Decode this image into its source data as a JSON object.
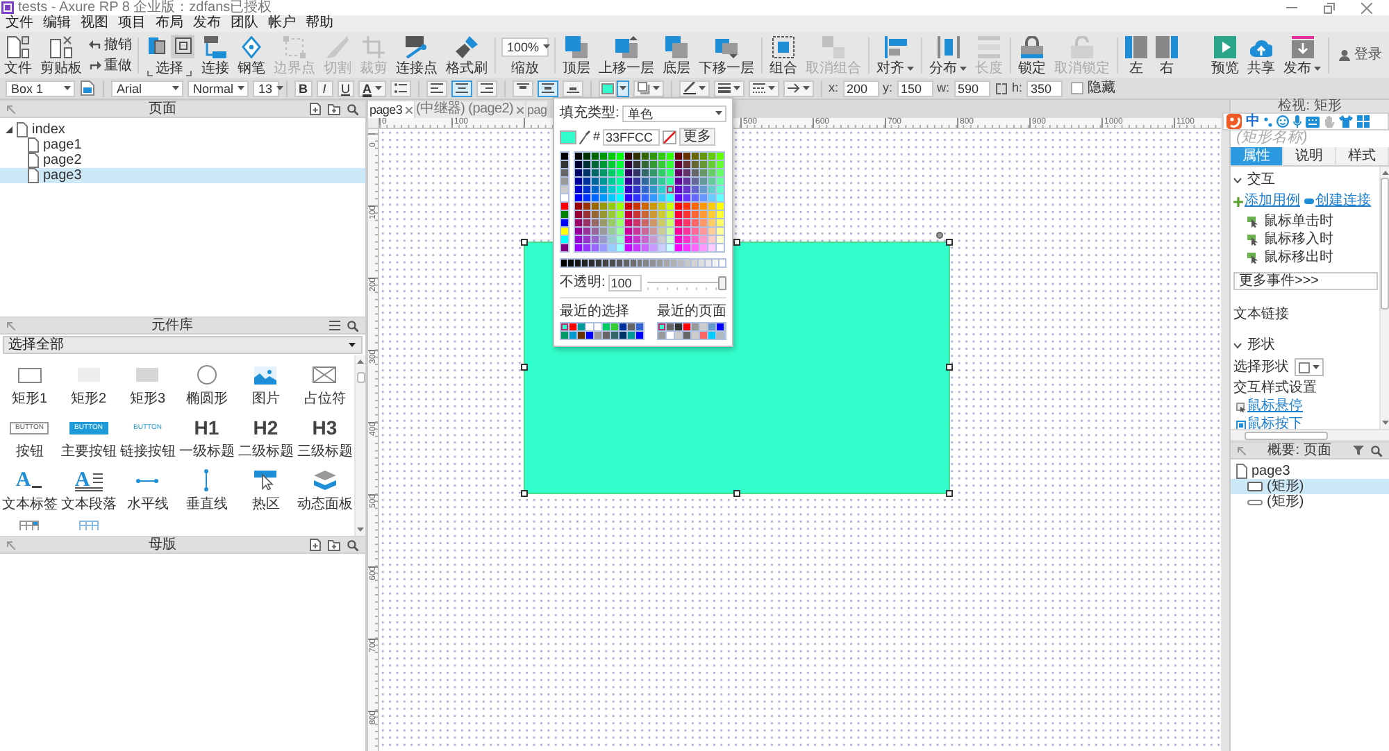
{
  "window": {
    "title": "tests - Axure RP 8 企业版：zdfans已授权"
  },
  "menu": [
    "文件",
    "编辑",
    "视图",
    "项目",
    "布局",
    "发布",
    "团队",
    "帐户",
    "帮助"
  ],
  "toolbar": {
    "groups": [
      [
        {
          "kind": "file",
          "label": "文件",
          "disabled": false
        },
        {
          "kind": "paste",
          "label": "剪贴板",
          "disabled": false
        },
        {
          "kind": "history",
          "undo": "撤销",
          "redo": "重做",
          "disabled": false
        }
      ],
      [
        {
          "kind": "select",
          "label": "选择",
          "modes": [
            {
              "kind": "intersect",
              "selected": false
            },
            {
              "kind": "contain",
              "selected": true
            }
          ],
          "disabled": false
        },
        {
          "kind": "connect",
          "label": "连接",
          "disabled": false
        },
        {
          "kind": "pen",
          "label": "钢笔",
          "disabled": false
        },
        {
          "kind": "points",
          "label": "边界点",
          "disabled": true
        },
        {
          "kind": "slice",
          "label": "切割",
          "disabled": true
        },
        {
          "kind": "crop",
          "label": "裁剪",
          "disabled": true
        },
        {
          "kind": "connector",
          "label": "连接点",
          "disabled": false
        },
        {
          "kind": "painter",
          "label": "格式刷",
          "disabled": false
        }
      ],
      [
        {
          "kind": "zoom",
          "value": "100%",
          "label": "缩放"
        }
      ],
      [
        {
          "kind": "top",
          "label": "顶层",
          "disabled": false
        },
        {
          "kind": "forward",
          "label": "上移一层",
          "disabled": false
        },
        {
          "kind": "bottom",
          "label": "底层",
          "disabled": false
        },
        {
          "kind": "backward",
          "label": "下移一层",
          "disabled": false
        }
      ],
      [
        {
          "kind": "group",
          "label": "组合",
          "disabled": false
        },
        {
          "kind": "ungroup",
          "label": "取消组合",
          "disabled": true
        }
      ],
      [
        {
          "kind": "align",
          "label": "对齐",
          "dropdown": true,
          "disabled": false
        }
      ],
      [
        {
          "kind": "distribute",
          "label": "分布",
          "dropdown": true,
          "disabled": false
        },
        {
          "kind": "spacing",
          "label": "长度",
          "disabled": true
        }
      ],
      [
        {
          "kind": "lock",
          "label": "锁定",
          "disabled": false
        },
        {
          "kind": "unlock",
          "label": "取消锁定",
          "disabled": true
        }
      ],
      [
        {
          "kind": "left-panel",
          "label": "左",
          "disabled": false
        },
        {
          "kind": "right-panel",
          "label": "右",
          "disabled": false
        }
      ]
    ],
    "right": [
      {
        "kind": "preview",
        "label": "预览",
        "disabled": false
      },
      {
        "kind": "share",
        "label": "共享",
        "disabled": false
      },
      {
        "kind": "publish",
        "label": "发布",
        "dropdown": true,
        "disabled": false
      }
    ],
    "login": "登录"
  },
  "format_bar": {
    "widget": "Box 1",
    "font": "Arial",
    "weight": "Normal",
    "size": "13",
    "styles": [
      {
        "kind": "bold",
        "label": "B",
        "on": false
      },
      {
        "kind": "italic",
        "label": "I",
        "on": false
      },
      {
        "kind": "underline",
        "label": "U",
        "on": false
      }
    ],
    "text_color": {
      "label": "A"
    },
    "h_align": [
      {
        "kind": "left",
        "selected": false
      },
      {
        "kind": "center",
        "selected": true
      },
      {
        "kind": "right",
        "selected": false
      }
    ],
    "v_align": [
      {
        "kind": "top",
        "selected": false
      },
      {
        "kind": "middle",
        "selected": true
      },
      {
        "kind": "bottom",
        "selected": false
      }
    ],
    "fill": {
      "open": true
    },
    "geometry": [
      {
        "kind": "coord",
        "label": "x:",
        "value": "200"
      },
      {
        "kind": "coord",
        "label": "y:",
        "value": "150"
      },
      {
        "kind": "coord",
        "label": "w:",
        "value": "590"
      },
      {
        "kind": "height",
        "label": "h:",
        "value": "350"
      }
    ],
    "hidden": {
      "label": "隐藏",
      "checked": false
    }
  },
  "pages_panel": {
    "title": "页面",
    "tree": [
      {
        "label": "index",
        "expanded": true,
        "selected": false,
        "children": [
          {
            "label": "page1",
            "selected": false
          },
          {
            "label": "page2",
            "selected": false
          },
          {
            "label": "page3",
            "selected": true
          }
        ]
      }
    ]
  },
  "library_panel": {
    "title": "元件库",
    "filter": "选择全部",
    "widgets": [
      {
        "kind": "rect",
        "label": "矩形1"
      },
      {
        "kind": "rect-light",
        "label": "矩形2"
      },
      {
        "kind": "rect-gray",
        "label": "矩形3"
      },
      {
        "kind": "ellipse",
        "label": "椭圆形"
      },
      {
        "kind": "image",
        "label": "图片"
      },
      {
        "kind": "placeholder",
        "label": "占位符"
      },
      {
        "kind": "button",
        "glyph": "BUTTON",
        "label": "按钮"
      },
      {
        "kind": "button-primary",
        "glyph": "BUTTON",
        "label": "主要按钮"
      },
      {
        "kind": "button-link",
        "glyph": "BUTTON",
        "label": "链接按钮"
      },
      {
        "kind": "heading",
        "glyph": "H1",
        "label": "一级标题"
      },
      {
        "kind": "heading",
        "glyph": "H2",
        "label": "二级标题"
      },
      {
        "kind": "heading",
        "glyph": "H3",
        "label": "三级标题"
      },
      {
        "kind": "text-label",
        "glyph": "A",
        "label": "文本标签"
      },
      {
        "kind": "text-paragraph",
        "glyph": "A",
        "label": "文本段落"
      },
      {
        "kind": "hline",
        "label": "水平线"
      },
      {
        "kind": "vline",
        "label": "垂直线"
      },
      {
        "kind": "hotspot",
        "label": "热区"
      },
      {
        "kind": "dynamic-panel",
        "label": "动态面板"
      },
      {
        "kind": "table"
      },
      {
        "kind": "repeater"
      }
    ]
  },
  "masters_panel": {
    "title": "母版"
  },
  "editor": {
    "tabs": [
      {
        "label": "page3",
        "selected": true,
        "closable": true
      },
      {
        "label": "(中继器) (page2)",
        "selected": false,
        "closable": true
      },
      {
        "label": "pag",
        "selected": false
      }
    ],
    "rulers": {
      "horizontal": [
        "0",
        "100",
        "500",
        "600",
        "700",
        "800",
        "900",
        "1000",
        "1100"
      ],
      "vertical": [
        "0",
        "100",
        "200",
        "300",
        "400",
        "500",
        "600",
        "700",
        "800"
      ]
    },
    "widgets": [
      {
        "kind": "rectangle",
        "color": "#33ffcc",
        "selected": true
      }
    ]
  },
  "fill_picker": {
    "type_label": "填充类型:",
    "type": "单色",
    "hash": "#",
    "hex": "33FFCC",
    "more": "更多",
    "basic": [
      {
        "color": "#000000",
        "selected": false
      },
      {
        "color": "#333333",
        "selected": false
      },
      {
        "color": "#666666",
        "selected": false
      },
      {
        "color": "#999999",
        "selected": false
      },
      {
        "color": "#cccccc",
        "selected": false
      },
      {
        "color": "#ffffff",
        "selected": false
      },
      {
        "color": "#ff0000",
        "selected": false
      },
      {
        "color": "#008000",
        "selected": false
      },
      {
        "color": "#0000ff",
        "selected": false
      },
      {
        "color": "#ffff00",
        "selected": false
      },
      {
        "color": "#00ffff",
        "selected": false
      },
      {
        "color": "#800080",
        "selected": false
      }
    ],
    "palette": [
      {
        "color": "#000000",
        "selected": false
      },
      {
        "color": "#003300",
        "selected": false
      },
      {
        "color": "#006600",
        "selected": false
      },
      {
        "color": "#009900",
        "selected": false
      },
      {
        "color": "#00cc00",
        "selected": false
      },
      {
        "color": "#00ff00",
        "selected": false
      },
      {
        "color": "#330000",
        "selected": false
      },
      {
        "color": "#333300",
        "selected": false
      },
      {
        "color": "#336600",
        "selected": false
      },
      {
        "color": "#339900",
        "selected": false
      },
      {
        "color": "#33cc00",
        "selected": false
      },
      {
        "color": "#33ff00",
        "selected": false
      },
      {
        "color": "#660000",
        "selected": false
      },
      {
        "color": "#663300",
        "selected": false
      },
      {
        "color": "#666600",
        "selected": false
      },
      {
        "color": "#669900",
        "selected": false
      },
      {
        "color": "#66cc00",
        "selected": false
      },
      {
        "color": "#66ff00",
        "selected": false
      },
      {
        "color": "#000033",
        "selected": false
      },
      {
        "color": "#003333",
        "selected": false
      },
      {
        "color": "#006633",
        "selected": false
      },
      {
        "color": "#009933",
        "selected": false
      },
      {
        "color": "#00cc33",
        "selected": false
      },
      {
        "color": "#00ff33",
        "selected": false
      },
      {
        "color": "#330033",
        "selected": false
      },
      {
        "color": "#333333",
        "selected": false
      },
      {
        "color": "#336633",
        "selected": false
      },
      {
        "color": "#339933",
        "selected": false
      },
      {
        "color": "#33cc33",
        "selected": false
      },
      {
        "color": "#33ff33",
        "selected": false
      },
      {
        "color": "#660033",
        "selected": false
      },
      {
        "color": "#663333",
        "selected": false
      },
      {
        "color": "#666633",
        "selected": false
      },
      {
        "color": "#669933",
        "selected": false
      },
      {
        "color": "#66cc33",
        "selected": false
      },
      {
        "color": "#66ff33",
        "selected": false
      },
      {
        "color": "#000066",
        "selected": false
      },
      {
        "color": "#003366",
        "selected": false
      },
      {
        "color": "#006666",
        "selected": false
      },
      {
        "color": "#009966",
        "selected": false
      },
      {
        "color": "#00cc66",
        "selected": false
      },
      {
        "color": "#00ff66",
        "selected": false
      },
      {
        "color": "#330066",
        "selected": false
      },
      {
        "color": "#333366",
        "selected": false
      },
      {
        "color": "#336666",
        "selected": false
      },
      {
        "color": "#339966",
        "selected": false
      },
      {
        "color": "#33cc66",
        "selected": false
      },
      {
        "color": "#33ff66",
        "selected": false
      },
      {
        "color": "#660066",
        "selected": false
      },
      {
        "color": "#663366",
        "selected": false
      },
      {
        "color": "#666666",
        "selected": false
      },
      {
        "color": "#669966",
        "selected": false
      },
      {
        "color": "#66cc66",
        "selected": false
      },
      {
        "color": "#66ff66",
        "selected": false
      },
      {
        "color": "#000099",
        "selected": false
      },
      {
        "color": "#003399",
        "selected": false
      },
      {
        "color": "#006699",
        "selected": false
      },
      {
        "color": "#009999",
        "selected": false
      },
      {
        "color": "#00cc99",
        "selected": false
      },
      {
        "color": "#00ff99",
        "selected": false
      },
      {
        "color": "#330099",
        "selected": false
      },
      {
        "color": "#333399",
        "selected": false
      },
      {
        "color": "#336699",
        "selected": false
      },
      {
        "color": "#339999",
        "selected": false
      },
      {
        "color": "#33cc99",
        "selected": false
      },
      {
        "color": "#33ff99",
        "selected": false
      },
      {
        "color": "#660099",
        "selected": false
      },
      {
        "color": "#663399",
        "selected": false
      },
      {
        "color": "#666699",
        "selected": false
      },
      {
        "color": "#669999",
        "selected": false
      },
      {
        "color": "#66cc99",
        "selected": false
      },
      {
        "color": "#66ff99",
        "selected": false
      },
      {
        "color": "#0000cc",
        "selected": false
      },
      {
        "color": "#0033cc",
        "selected": false
      },
      {
        "color": "#0066cc",
        "selected": false
      },
      {
        "color": "#0099cc",
        "selected": false
      },
      {
        "color": "#00cccc",
        "selected": false
      },
      {
        "color": "#00ffcc",
        "selected": false
      },
      {
        "color": "#3300cc",
        "selected": false
      },
      {
        "color": "#3333cc",
        "selected": false
      },
      {
        "color": "#3366cc",
        "selected": false
      },
      {
        "color": "#3399cc",
        "selected": false
      },
      {
        "color": "#33cccc",
        "selected": false
      },
      {
        "color": "#33ffcc",
        "selected": true
      },
      {
        "color": "#6600cc",
        "selected": false
      },
      {
        "color": "#6633cc",
        "selected": false
      },
      {
        "color": "#6666cc",
        "selected": false
      },
      {
        "color": "#6699cc",
        "selected": false
      },
      {
        "color": "#66cccc",
        "selected": false
      },
      {
        "color": "#66ffcc",
        "selected": false
      },
      {
        "color": "#0000ff",
        "selected": false
      },
      {
        "color": "#0033ff",
        "selected": false
      },
      {
        "color": "#0066ff",
        "selected": false
      },
      {
        "color": "#0099ff",
        "selected": false
      },
      {
        "color": "#00ccff",
        "selected": false
      },
      {
        "color": "#00ffff",
        "selected": false
      },
      {
        "color": "#3300ff",
        "selected": false
      },
      {
        "color": "#3333ff",
        "selected": false
      },
      {
        "color": "#3366ff",
        "selected": false
      },
      {
        "color": "#3399ff",
        "selected": false
      },
      {
        "color": "#33ccff",
        "selected": false
      },
      {
        "color": "#33ffff",
        "selected": false
      },
      {
        "color": "#6600ff",
        "selected": false
      },
      {
        "color": "#6633ff",
        "selected": false
      },
      {
        "color": "#6666ff",
        "selected": false
      },
      {
        "color": "#6699ff",
        "selected": false
      },
      {
        "color": "#66ccff",
        "selected": false
      },
      {
        "color": "#66ffff",
        "selected": false
      },
      {
        "color": "#990000",
        "selected": false
      },
      {
        "color": "#993300",
        "selected": false
      },
      {
        "color": "#996600",
        "selected": false
      },
      {
        "color": "#999900",
        "selected": false
      },
      {
        "color": "#99cc00",
        "selected": false
      },
      {
        "color": "#99ff00",
        "selected": false
      },
      {
        "color": "#cc0000",
        "selected": false
      },
      {
        "color": "#cc3300",
        "selected": false
      },
      {
        "color": "#cc6600",
        "selected": false
      },
      {
        "color": "#cc9900",
        "selected": false
      },
      {
        "color": "#cccc00",
        "selected": false
      },
      {
        "color": "#ccff00",
        "selected": false
      },
      {
        "color": "#ff0000",
        "selected": false
      },
      {
        "color": "#ff3300",
        "selected": false
      },
      {
        "color": "#ff6600",
        "selected": false
      },
      {
        "color": "#ff9900",
        "selected": false
      },
      {
        "color": "#ffcc00",
        "selected": false
      },
      {
        "color": "#ffff00",
        "selected": false
      },
      {
        "color": "#990033",
        "selected": false
      },
      {
        "color": "#993333",
        "selected": false
      },
      {
        "color": "#996633",
        "selected": false
      },
      {
        "color": "#999933",
        "selected": false
      },
      {
        "color": "#99cc33",
        "selected": false
      },
      {
        "color": "#99ff33",
        "selected": false
      },
      {
        "color": "#cc0033",
        "selected": false
      },
      {
        "color": "#cc3333",
        "selected": false
      },
      {
        "color": "#cc6633",
        "selected": false
      },
      {
        "color": "#cc9933",
        "selected": false
      },
      {
        "color": "#cccc33",
        "selected": false
      },
      {
        "color": "#ccff33",
        "selected": false
      },
      {
        "color": "#ff0033",
        "selected": false
      },
      {
        "color": "#ff3333",
        "selected": false
      },
      {
        "color": "#ff6633",
        "selected": false
      },
      {
        "color": "#ff9933",
        "selected": false
      },
      {
        "color": "#ffcc33",
        "selected": false
      },
      {
        "color": "#ffff33",
        "selected": false
      },
      {
        "color": "#990066",
        "selected": false
      },
      {
        "color": "#993366",
        "selected": false
      },
      {
        "color": "#996666",
        "selected": false
      },
      {
        "color": "#999966",
        "selected": false
      },
      {
        "color": "#99cc66",
        "selected": false
      },
      {
        "color": "#99ff66",
        "selected": false
      },
      {
        "color": "#cc0066",
        "selected": false
      },
      {
        "color": "#cc3366",
        "selected": false
      },
      {
        "color": "#cc6666",
        "selected": false
      },
      {
        "color": "#cc9966",
        "selected": false
      },
      {
        "color": "#cccc66",
        "selected": false
      },
      {
        "color": "#ccff66",
        "selected": false
      },
      {
        "color": "#ff0066",
        "selected": false
      },
      {
        "color": "#ff3366",
        "selected": false
      },
      {
        "color": "#ff6666",
        "selected": false
      },
      {
        "color": "#ff9966",
        "selected": false
      },
      {
        "color": "#ffcc66",
        "selected": false
      },
      {
        "color": "#ffff66",
        "selected": false
      },
      {
        "color": "#990099",
        "selected": false
      },
      {
        "color": "#993399",
        "selected": false
      },
      {
        "color": "#996699",
        "selected": false
      },
      {
        "color": "#999999",
        "selected": false
      },
      {
        "color": "#99cc99",
        "selected": false
      },
      {
        "color": "#99ff99",
        "selected": false
      },
      {
        "color": "#cc0099",
        "selected": false
      },
      {
        "color": "#cc3399",
        "selected": false
      },
      {
        "color": "#cc6699",
        "selected": false
      },
      {
        "color": "#cc9999",
        "selected": false
      },
      {
        "color": "#cccc99",
        "selected": false
      },
      {
        "color": "#ccff99",
        "selected": false
      },
      {
        "color": "#ff0099",
        "selected": false
      },
      {
        "color": "#ff3399",
        "selected": false
      },
      {
        "color": "#ff6699",
        "selected": false
      },
      {
        "color": "#ff9999",
        "selected": false
      },
      {
        "color": "#ffcc99",
        "selected": false
      },
      {
        "color": "#ffff99",
        "selected": false
      },
      {
        "color": "#9900cc",
        "selected": false
      },
      {
        "color": "#9933cc",
        "selected": false
      },
      {
        "color": "#9966cc",
        "selected": false
      },
      {
        "color": "#9999cc",
        "selected": false
      },
      {
        "color": "#99cccc",
        "selected": false
      },
      {
        "color": "#99ffcc",
        "selected": false
      },
      {
        "color": "#cc00cc",
        "selected": false
      },
      {
        "color": "#cc33cc",
        "selected": false
      },
      {
        "color": "#cc66cc",
        "selected": false
      },
      {
        "color": "#cc99cc",
        "selected": false
      },
      {
        "color": "#cccccc",
        "selected": false
      },
      {
        "color": "#ccffcc",
        "selected": false
      },
      {
        "color": "#ff00cc",
        "selected": false
      },
      {
        "color": "#ff33cc",
        "selected": false
      },
      {
        "color": "#ff66cc",
        "selected": false
      },
      {
        "color": "#ff99cc",
        "selected": false
      },
      {
        "color": "#ffcccc",
        "selected": false
      },
      {
        "color": "#ffffcc",
        "selected": false
      },
      {
        "color": "#9900ff",
        "selected": false
      },
      {
        "color": "#9933ff",
        "selected": false
      },
      {
        "color": "#9966ff",
        "selected": false
      },
      {
        "color": "#9999ff",
        "selected": false
      },
      {
        "color": "#99ccff",
        "selected": false
      },
      {
        "color": "#99ffff",
        "selected": false
      },
      {
        "color": "#cc00ff",
        "selected": false
      },
      {
        "color": "#cc33ff",
        "selected": false
      },
      {
        "color": "#cc66ff",
        "selected": false
      },
      {
        "color": "#cc99ff",
        "selected": false
      },
      {
        "color": "#ccccff",
        "selected": false
      },
      {
        "color": "#ccffff",
        "selected": false
      },
      {
        "color": "#ff00ff",
        "selected": false
      },
      {
        "color": "#ff33ff",
        "selected": false
      },
      {
        "color": "#ff66ff",
        "selected": false
      },
      {
        "color": "#ff99ff",
        "selected": false
      },
      {
        "color": "#ffccff",
        "selected": false
      },
      {
        "color": "#ffffff",
        "selected": false
      }
    ],
    "grays": [
      {
        "color": "#000000",
        "selected": false
      },
      {
        "color": "#0b0b0b",
        "selected": false
      },
      {
        "color": "#161616",
        "selected": false
      },
      {
        "color": "#212121",
        "selected": false
      },
      {
        "color": "#2c2c2c",
        "selected": false
      },
      {
        "color": "#373737",
        "selected": false
      },
      {
        "color": "#434343",
        "selected": false
      },
      {
        "color": "#4e4e4e",
        "selected": false
      },
      {
        "color": "#595959",
        "selected": false
      },
      {
        "color": "#646464",
        "selected": false
      },
      {
        "color": "#6f6f6f",
        "selected": false
      },
      {
        "color": "#7a7a7a",
        "selected": false
      },
      {
        "color": "#858585",
        "selected": false
      },
      {
        "color": "#909090",
        "selected": false
      },
      {
        "color": "#9b9b9b",
        "selected": false
      },
      {
        "color": "#a6a6a6",
        "selected": false
      },
      {
        "color": "#b1b1b1",
        "selected": false
      },
      {
        "color": "#bcbcbc",
        "selected": false
      },
      {
        "color": "#c8c8c8",
        "selected": false
      },
      {
        "color": "#d3d3d3",
        "selected": false
      },
      {
        "color": "#dedede",
        "selected": false
      },
      {
        "color": "#e9e9e9",
        "selected": false
      },
      {
        "color": "#f4f4f4",
        "selected": false
      },
      {
        "color": "#ffffff",
        "selected": false
      }
    ],
    "opacity": {
      "label": "不透明:",
      "value": "100",
      "level": 1
    },
    "recent_choices": {
      "title": "最近的选择",
      "swatches": [
        {
          "color": "#33ffcc",
          "selected": true
        },
        {
          "color": "#ff0000",
          "selected": false
        },
        {
          "color": "#009999",
          "selected": false
        },
        {
          "color": "#ffffff",
          "selected": false
        },
        {
          "color": "#ffffff",
          "selected": false
        },
        {
          "color": "#00cc66",
          "selected": false
        },
        {
          "color": "#33cc33",
          "selected": false
        },
        {
          "color": "#003399",
          "selected": false
        },
        {
          "color": "#666666",
          "selected": false
        },
        {
          "color": "#3366cc",
          "selected": false
        },
        {
          "color": "#009966",
          "selected": false
        },
        {
          "color": "#0099cc",
          "selected": false
        },
        {
          "color": "#663300",
          "selected": false
        },
        {
          "color": "#0000ff",
          "selected": false
        },
        {
          "color": "#999999",
          "selected": false
        },
        {
          "color": "#666666",
          "selected": false
        },
        {
          "color": "#336666",
          "selected": false
        },
        {
          "color": "#003366",
          "selected": false
        },
        {
          "color": "#009999",
          "selected": false
        },
        {
          "color": "#0000ff",
          "selected": false
        }
      ]
    },
    "recent_page": {
      "title": "最近的页面",
      "swatches": [
        {
          "color": "#33ffcc",
          "selected": true
        },
        {
          "color": "#666666",
          "selected": false
        },
        {
          "color": "#333333",
          "selected": false
        },
        {
          "color": "#ff0000",
          "selected": false
        },
        {
          "color": "#999999",
          "selected": false
        },
        {
          "color": "#cccccc",
          "selected": false
        },
        {
          "color": "#6699cc",
          "selected": false
        },
        {
          "color": "#0000ff",
          "selected": false
        },
        {
          "color": "#999999",
          "selected": false
        },
        {
          "color": "#ffffff",
          "selected": false
        },
        {
          "color": "#cccccc",
          "selected": false
        },
        {
          "color": "#666666",
          "selected": false
        },
        {
          "color": "#cccccc",
          "selected": false
        },
        {
          "color": "#ff6666",
          "selected": false
        },
        {
          "color": "#00ccff",
          "selected": false
        },
        {
          "color": "#b0b8c0",
          "selected": false
        }
      ]
    }
  },
  "inspector": {
    "title": "检视: 矩形",
    "name_placeholder": "(矩形名称)",
    "tabs": [
      {
        "label": "属性",
        "selected": true
      },
      {
        "label": "说明",
        "selected": false
      },
      {
        "label": "样式",
        "selected": false
      }
    ],
    "sections": [
      {
        "kind": "interactions",
        "title": "交互",
        "expanded": true,
        "add_case": "添加用例",
        "create_link": "创建连接",
        "events": [
          "鼠标单击时",
          "鼠标移入时",
          "鼠标移出时"
        ],
        "more_events": "更多事件>>>"
      },
      {
        "kind": "text-link",
        "title": "文本链接"
      },
      {
        "kind": "shape",
        "title": "形状",
        "expanded": true,
        "select_label": "选择形状",
        "styles_title": "交互样式设置",
        "style_links": [
          "鼠标悬停",
          "鼠标按下"
        ]
      }
    ]
  },
  "outline": {
    "title": "概要: 页面",
    "tree": [
      {
        "label": "page3",
        "selected": false,
        "children": [
          {
            "kind": "rectangle",
            "label": "(矩形)",
            "selected": true
          },
          {
            "kind": "line",
            "label": "(矩形)",
            "selected": false
          }
        ]
      }
    ]
  },
  "ime_bar": {
    "mode": "中"
  }
}
